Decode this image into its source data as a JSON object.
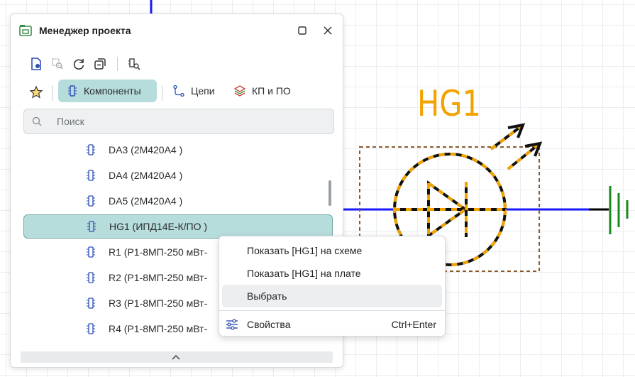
{
  "panel": {
    "title": "Менеджер проекта"
  },
  "tabs": {
    "components": "Компоненты",
    "nets": "Цепи",
    "pads": "КП и ПО"
  },
  "search": {
    "placeholder": "Поиск"
  },
  "tree": {
    "items": [
      {
        "label": "DA3 (2М420А4 )"
      },
      {
        "label": "DA4 (2М420А4 )"
      },
      {
        "label": "DA5 (2М420А4 )"
      },
      {
        "label": "HG1 (ИПД14Е-К/ПО )"
      },
      {
        "label": "R1 (Р1-8МП-250 мВт-"
      },
      {
        "label": "R2 (Р1-8МП-250 мВт-"
      },
      {
        "label": "R3 (Р1-8МП-250 мВт-"
      },
      {
        "label": "R4 (Р1-8МП-250 мВт-"
      }
    ]
  },
  "context_menu": {
    "show_on_schematic": "Показать [HG1] на схеме",
    "show_on_board": "Показать [HG1] на плате",
    "select": "Выбрать",
    "properties": "Свойства",
    "properties_shortcut": "Ctrl+Enter"
  },
  "schematic": {
    "refdes": "HG1",
    "colors": {
      "refdes": "#f2a300",
      "wire": "#1a1aff",
      "ground": "#1a8a1a",
      "selection_box": "#8b5a2b",
      "symbol_primary": "#111111",
      "symbol_secondary": "#f2a300"
    }
  },
  "colors": {
    "accent": "#b7dcdc",
    "accent_border": "#6fa8a8"
  },
  "icons": [
    "project-icon",
    "maximize-icon",
    "close-icon",
    "document-view-icon",
    "zoom-to-fit-icon",
    "refresh-icon",
    "collapse-icon",
    "search-component-icon",
    "star-icon",
    "component-icon",
    "net-icon",
    "layers-icon",
    "search-icon",
    "chip-icon",
    "settings-sliders-icon",
    "chevron-up-icon"
  ]
}
